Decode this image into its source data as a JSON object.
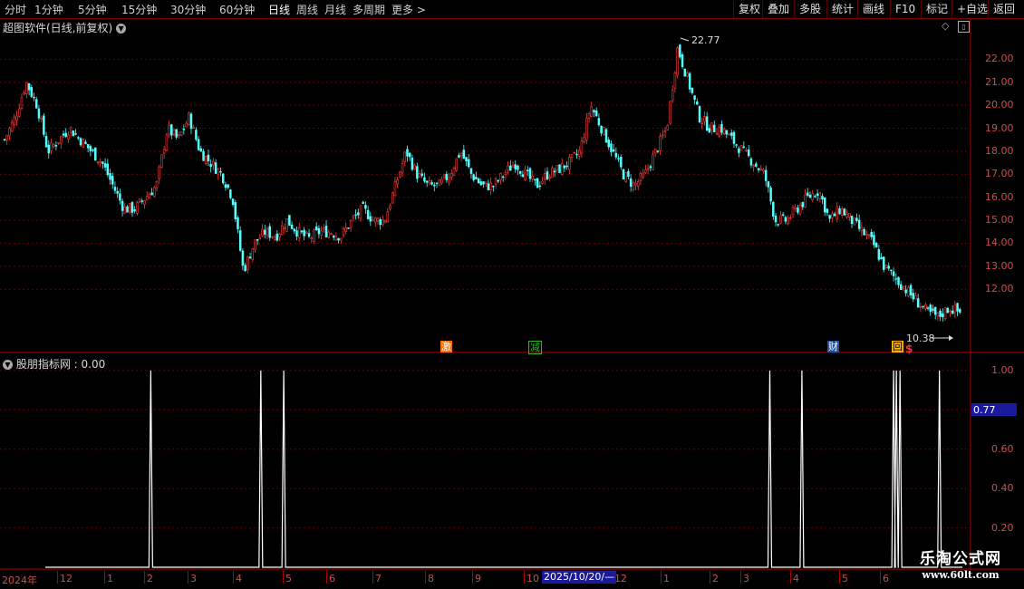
{
  "toolbar": {
    "periods": [
      "分时",
      "1分钟",
      "5分钟",
      "15分钟",
      "30分钟",
      "60分钟",
      "日线",
      "周线",
      "月线",
      "多周期",
      "更多 >"
    ],
    "active_period": "日线",
    "right_buttons": [
      "复权",
      "叠加",
      "多股",
      "统计",
      "画线",
      "F10",
      "标记",
      "+自选",
      "返回"
    ]
  },
  "main_chart": {
    "title": "超图软件(日线,前复权)",
    "max_label": "22.77",
    "min_label": "10.38",
    "y_ticks": [
      "22.00",
      "21.00",
      "20.00",
      "19.00",
      "18.00",
      "17.00",
      "16.00",
      "15.00",
      "14.00",
      "13.00",
      "12.00"
    ],
    "event_tags": [
      {
        "text": "激",
        "color": "#ff6a00"
      },
      {
        "text": "减",
        "color": "#20c020"
      },
      {
        "text": "财",
        "color": "#4aa0ff"
      },
      {
        "text": "回",
        "color": "#ffb000"
      }
    ],
    "dollar_mark": "$"
  },
  "indicator": {
    "title": "股朋指标网 : 0.00",
    "y_ticks": [
      "1.00",
      "0.60",
      "0.40",
      "0.20"
    ],
    "current_value_label": "0.77"
  },
  "x_axis": {
    "labels": [
      "2024年",
      "12",
      "1",
      "2",
      "3",
      "4",
      "5",
      "6",
      "7",
      "8",
      "9",
      "10",
      "12",
      "1",
      "2",
      "3",
      "4",
      "5",
      "6"
    ],
    "selected_date": "2025/10/20/—"
  },
  "watermark": {
    "line1": "乐淘公式网",
    "line2": "www.60lt.com"
  },
  "chart_data": [
    {
      "type": "candlestick",
      "title": "超图软件(日线,前复权)",
      "ylim": [
        10.0,
        23.0
      ],
      "max": 22.77,
      "min": 10.38,
      "approx_close_path": [
        18.5,
        19.5,
        21.0,
        20.0,
        18.0,
        18.5,
        19.0,
        18.5,
        18.0,
        17.5,
        16.5,
        15.5,
        15.5,
        16.0,
        16.5,
        19.0,
        18.5,
        19.5,
        18.0,
        17.5,
        17.0,
        16.0,
        12.8,
        14.0,
        14.5,
        14.3,
        15.0,
        14.5,
        14.2,
        14.5,
        14.5,
        14.3,
        15.0,
        15.5,
        15.0,
        15.0,
        16.5,
        18.0,
        17.0,
        16.5,
        16.5,
        17.0,
        18.0,
        17.0,
        16.5,
        16.5,
        17.0,
        17.5,
        17.0,
        16.5,
        17.0,
        17.2,
        17.5,
        18.0,
        20.0,
        19.0,
        18.0,
        17.0,
        16.5,
        17.0,
        18.0,
        19.0,
        22.5,
        21.0,
        19.5,
        19.0,
        19.0,
        18.5,
        18.0,
        17.5,
        17.0,
        15.0,
        15.0,
        15.5,
        16.0,
        16.3,
        15.0,
        15.5,
        15.0,
        14.5,
        14.0,
        13.0,
        12.5,
        12.0,
        11.5,
        11.0,
        10.8,
        11.2,
        11.0
      ]
    },
    {
      "type": "line",
      "title": "股朋指标网",
      "ylim": [
        0,
        1.05
      ],
      "signal_positions": [
        0.115,
        0.235,
        0.26,
        0.79,
        0.825,
        0.925,
        0.928,
        0.932,
        0.975
      ],
      "value_low": 0.0,
      "value_high": 1.0
    }
  ]
}
